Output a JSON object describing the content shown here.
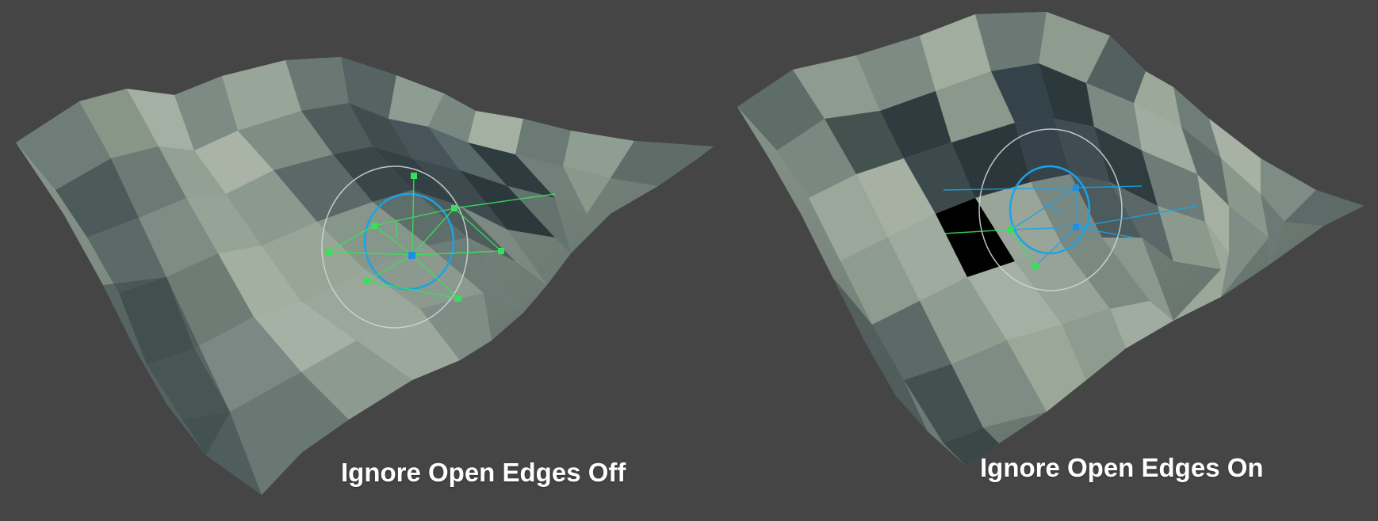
{
  "panels": [
    {
      "caption": "Ignore Open Edges Off",
      "brush_icon": "terrain-sculpt-brush-icon",
      "open_edges_ignored": false,
      "vertex_handles": 8
    },
    {
      "caption": "Ignore Open Edges On",
      "brush_icon": "terrain-sculpt-brush-icon",
      "open_edges_ignored": true,
      "vertex_handles": 4
    }
  ],
  "colors": {
    "background": "#454545",
    "terrain_light": "#9aa89b",
    "terrain_dark": "#3c4a4c",
    "brush_inner": "#1aa3e8",
    "brush_outer": "#cfd6d8",
    "selected_vertex": "#35e05a",
    "center_vertex": "#1f8fe0",
    "caption_text": "#ffffff"
  }
}
